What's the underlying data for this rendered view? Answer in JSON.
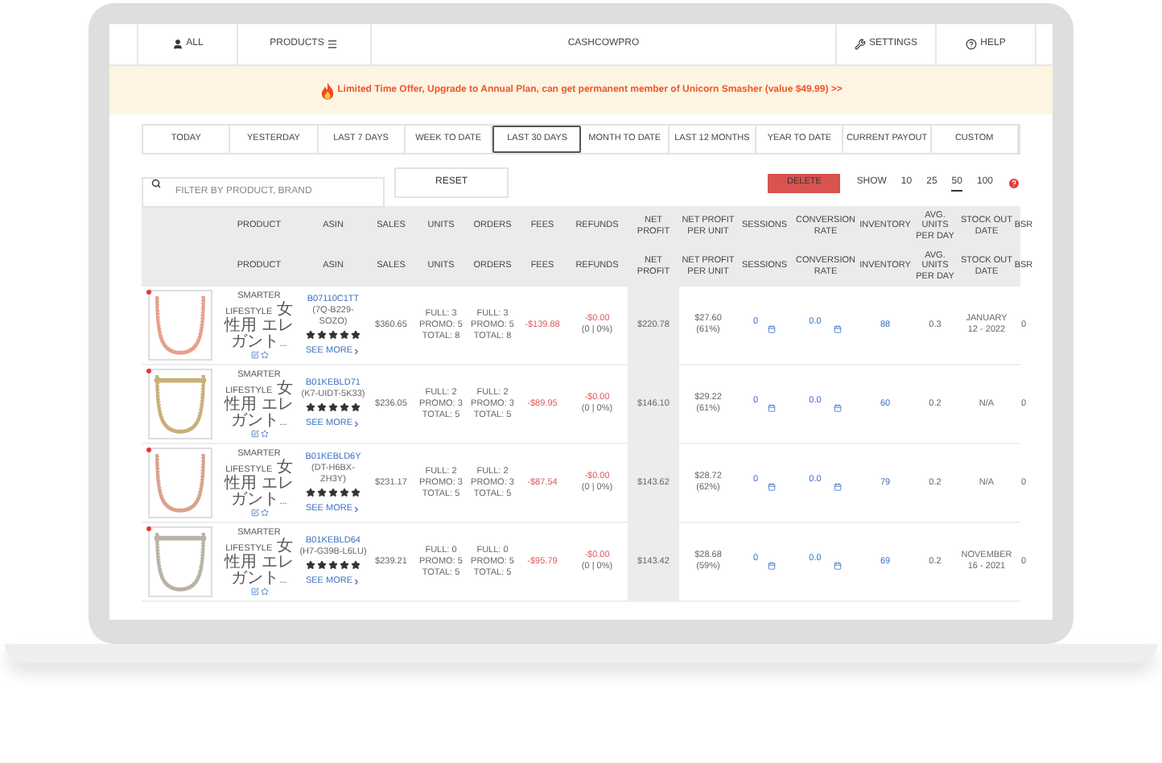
{
  "nav": {
    "items": [
      {
        "label": "ALL"
      },
      {
        "label": "PRODUCTS"
      },
      {
        "label": "CASHCOWPRO"
      },
      {
        "label": "SETTINGS"
      },
      {
        "label": "HELP"
      }
    ]
  },
  "banner": {
    "text": "Limited Time Offer, Upgrade to Annual Plan, can get permanent member of Unicorn Smasher (value $49.99) >>"
  },
  "date_ranges": [
    {
      "label": "TODAY",
      "selected": false
    },
    {
      "label": "YESTERDAY",
      "selected": false
    },
    {
      "label": "LAST 7 DAYS",
      "selected": false
    },
    {
      "label": "WEEK TO DATE",
      "selected": false
    },
    {
      "label": "LAST 30 DAYS",
      "selected": true
    },
    {
      "label": "MONTH TO DATE",
      "selected": false
    },
    {
      "label": "LAST 12 MONTHS",
      "selected": false
    },
    {
      "label": "YEAR TO DATE",
      "selected": false
    },
    {
      "label": "CURRENT PAYOUT",
      "selected": false
    },
    {
      "label": "CUSTOM",
      "selected": false
    }
  ],
  "filter": {
    "placeholder": "FILTER BY PRODUCT, BRAND",
    "reset": "RESET"
  },
  "delete_button": "DELETE",
  "show_label": "SHOW",
  "page_sizes": [
    {
      "label": "10",
      "selected": false
    },
    {
      "label": "25",
      "selected": false
    },
    {
      "label": "50",
      "selected": true
    },
    {
      "label": "100",
      "selected": false
    }
  ],
  "table": {
    "header_rows": [
      [
        "PRODUCT",
        "ASIN",
        "SALES",
        "UNITS",
        "ORDERS",
        "FEES",
        "REFUNDS",
        "NET PROFIT",
        "NET PROFIT PER UNIT",
        "SESSIONS",
        "CONVERSION RATE",
        "INVENTORY",
        "AVG. UNITS PER DAY",
        "STOCK OUT DATE",
        "BSR"
      ],
      [
        "PRODUCT",
        "ASIN",
        "SALES",
        "UNITS",
        "ORDERS",
        "FEES",
        "REFUNDS",
        "NET PROFIT",
        "NET PROFIT PER UNIT",
        "SESSIONS",
        "CONVERSION RATE",
        "INVENTORY",
        "AVG. UNITS PER DAY",
        "STOCK OUT DATE",
        "BSR"
      ]
    ],
    "rows": [
      {
        "product": "SMARTER LIFESTYLE 女性用 エレガント...",
        "asin": "B07110C1TT",
        "sku": "(7Q-B229-SOZO)",
        "stars": 5,
        "see_more": "SEE MORE",
        "sales": "$360.65",
        "units": [
          "FULL: 3",
          "PROMO: 5",
          "TOTAL: 8"
        ],
        "orders": [
          "FULL: 3",
          "PROMO: 5",
          "TOTAL: 8"
        ],
        "fees": "-$139.88",
        "refunds": "-$0.00",
        "refunds_rate": "(0 | 0%)",
        "net_profit": "$220.78",
        "per_unit": "$27.60",
        "per_unit_pct": "(61%)",
        "sessions": "0",
        "conversion": "0.0",
        "inventory": "88",
        "avg_units": "0.3",
        "stock_out": "JANUARY 12 - 2022",
        "bsr": "0"
      },
      {
        "product": "SMARTER LIFESTYLE 女性用 エレガント...",
        "asin": "B01KEBLD71",
        "sku": "(K7-UIDT-5K33)",
        "stars": 5,
        "see_more": "SEE MORE",
        "sales": "$236.05",
        "units": [
          "FULL: 2",
          "PROMO: 3",
          "TOTAL: 5"
        ],
        "orders": [
          "FULL: 2",
          "PROMO: 3",
          "TOTAL: 5"
        ],
        "fees": "-$89.95",
        "refunds": "-$0.00",
        "refunds_rate": "(0 | 0%)",
        "net_profit": "$146.10",
        "per_unit": "$29.22",
        "per_unit_pct": "(61%)",
        "sessions": "0",
        "conversion": "0.0",
        "inventory": "60",
        "avg_units": "0.2",
        "stock_out": "N/A",
        "bsr": "0"
      },
      {
        "product": "SMARTER LIFESTYLE 女性用 エレガント...",
        "asin": "B01KEBLD6Y",
        "sku": "(DT-H6BX-ZH3Y)",
        "stars": 5,
        "see_more": "SEE MORE",
        "sales": "$231.17",
        "units": [
          "FULL: 2",
          "PROMO: 3",
          "TOTAL: 5"
        ],
        "orders": [
          "FULL: 2",
          "PROMO: 3",
          "TOTAL: 5"
        ],
        "fees": "-$87.54",
        "refunds": "-$0.00",
        "refunds_rate": "(0 | 0%)",
        "net_profit": "$143.62",
        "per_unit": "$28.72",
        "per_unit_pct": "(62%)",
        "sessions": "0",
        "conversion": "0.0",
        "inventory": "79",
        "avg_units": "0.2",
        "stock_out": "N/A",
        "bsr": "0"
      },
      {
        "product": "SMARTER LIFESTYLE 女性用 エレガント...",
        "asin": "B01KEBLD64",
        "sku": "(H7-G39B-L6LU)",
        "stars": 5,
        "see_more": "SEE MORE",
        "sales": "$239.21",
        "units": [
          "FULL: 0",
          "PROMO: 5",
          "TOTAL: 5"
        ],
        "orders": [
          "FULL: 0",
          "PROMO: 5",
          "TOTAL: 5"
        ],
        "fees": "-$95.79",
        "refunds": "-$0.00",
        "refunds_rate": "(0 | 0%)",
        "net_profit": "$143.42",
        "per_unit": "$28.68",
        "per_unit_pct": "(59%)",
        "sessions": "0",
        "conversion": "0.0",
        "inventory": "69",
        "avg_units": "0.2",
        "stock_out": "NOVEMBER 16 - 2021",
        "bsr": "0"
      }
    ]
  }
}
